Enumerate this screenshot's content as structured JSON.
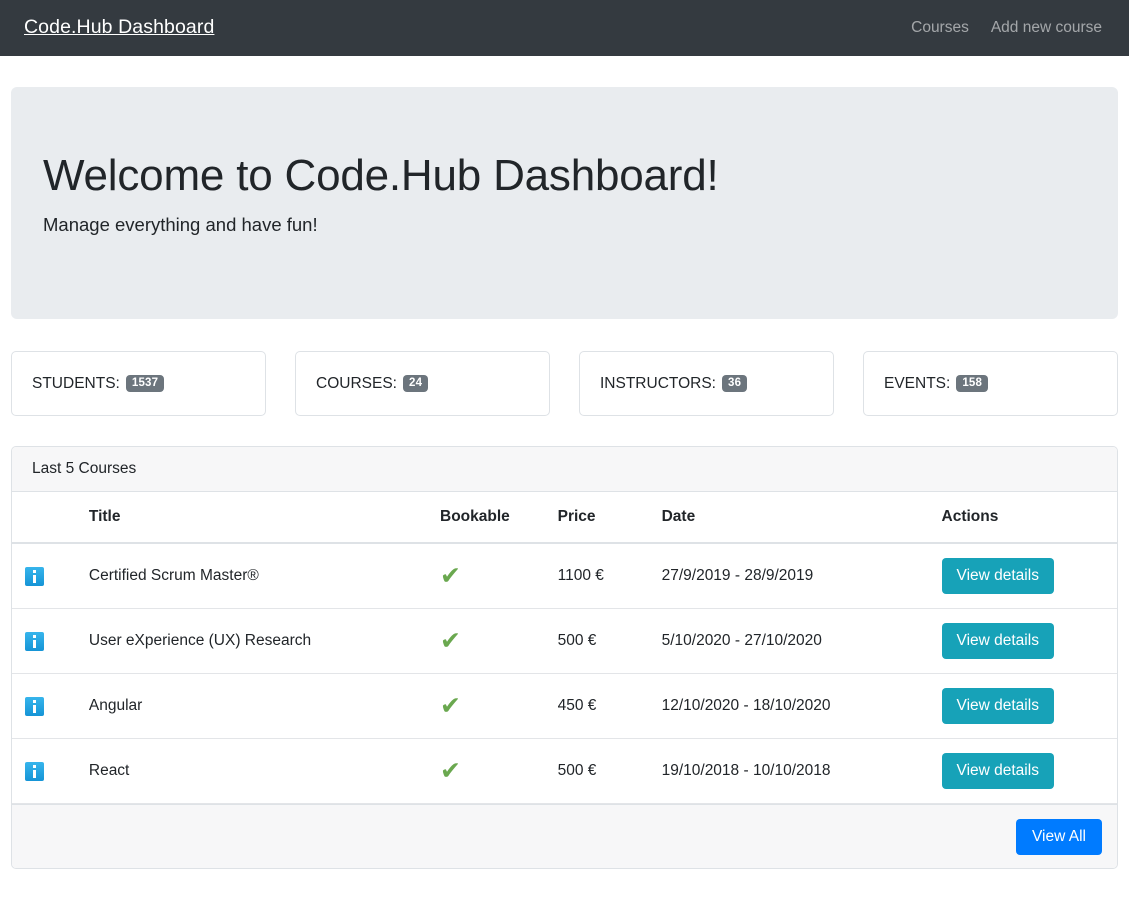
{
  "navbar": {
    "brand": "Code.Hub Dashboard",
    "links": [
      {
        "label": "Courses",
        "name": "nav-link-courses"
      },
      {
        "label": "Add new course",
        "name": "nav-link-add-new-course"
      }
    ]
  },
  "hero": {
    "title": "Welcome to Code.Hub Dashboard!",
    "subtitle": "Manage everything and have fun!",
    "background": "#e9ecef"
  },
  "stats": [
    {
      "label": "STUDENTS:",
      "value": "1537",
      "name": "stat-card-students"
    },
    {
      "label": "COURSES:",
      "value": "24",
      "name": "stat-card-courses"
    },
    {
      "label": "INSTRUCTORS:",
      "value": "36",
      "name": "stat-card-instructors"
    },
    {
      "label": "EVENTS:",
      "value": "158",
      "name": "stat-card-events"
    }
  ],
  "badge_color": "#6c757d",
  "table": {
    "header_title": "Last 5 Courses",
    "columns": {
      "icon": "",
      "title": "Title",
      "bookable": "Bookable",
      "price": "Price",
      "date": "Date",
      "actions": "Actions"
    },
    "rows": [
      {
        "icon": "info-icon",
        "title": "Certified Scrum Master®",
        "bookable": "✔",
        "price": "1100 €",
        "date": "27/9/2019 - 28/9/2019",
        "action_label": "View details"
      },
      {
        "icon": "info-icon",
        "title": "User eXperience (UX) Research",
        "bookable": "✔",
        "price": "500 €",
        "date": "5/10/2020 - 27/10/2020",
        "action_label": "View details"
      },
      {
        "icon": "info-icon",
        "title": "Angular",
        "bookable": "✔",
        "price": "450 €",
        "date": "12/10/2020 - 18/10/2020",
        "action_label": "View details"
      },
      {
        "icon": "info-icon",
        "title": "React",
        "bookable": "✔",
        "price": "500 €",
        "date": "19/10/2018 - 10/10/2018",
        "action_label": "View details"
      }
    ],
    "footer": {
      "view_all_label": "View All"
    }
  },
  "colors": {
    "navbar_bg": "#343a40",
    "action_button": "#17a2b8",
    "primary_button": "#007bff",
    "check_green": "#6aa84f",
    "info_icon_blue": "#1594d6"
  }
}
